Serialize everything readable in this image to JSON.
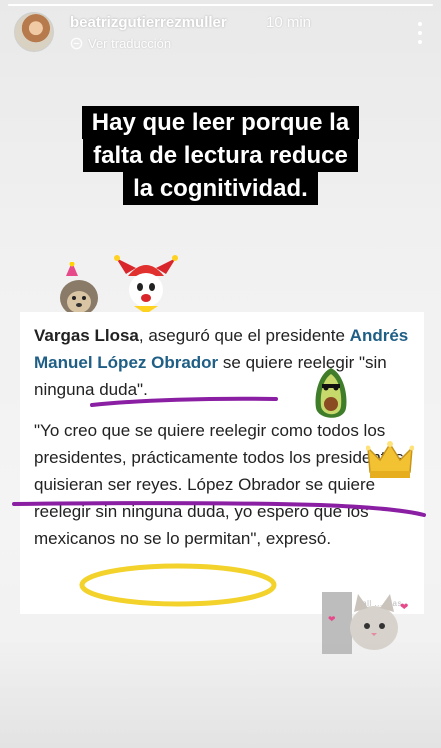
{
  "story": {
    "progress": 1.0,
    "username": "beatrizgutierrezmuller",
    "time_ago": "10 min",
    "translate_label": "Ver traducción",
    "caption_lines": [
      "Hay que leer porque la",
      "falta de lectura reduce",
      "la cognitividad."
    ]
  },
  "article": {
    "p1_name": "Vargas Llosa",
    "p1_text_a": ", aseguró que el presidente",
    "p1_link": "Andrés Manuel López Obrador",
    "p1_text_b": " se quiere reelegir \"sin ninguna duda\".",
    "p2_text": "\"Yo creo que se quiere reelegir como todos los presidentes, prácticamente todos los presidentes quisieran ser reyes. López Obrador se quiere reelegir sin ninguna duda, yo espero que los mexicanos no se lo permitan\", expresó."
  },
  "colors": {
    "highlight_purple": "#8a1fa3",
    "circle_yellow": "#f2d22b",
    "link_blue": "#1f5f86"
  },
  "icons": [
    "translate-icon",
    "more-options-icon",
    "hedgehog-sticker",
    "jester-sticker",
    "avocado-sticker",
    "crown-sticker",
    "cat-sticker"
  ]
}
